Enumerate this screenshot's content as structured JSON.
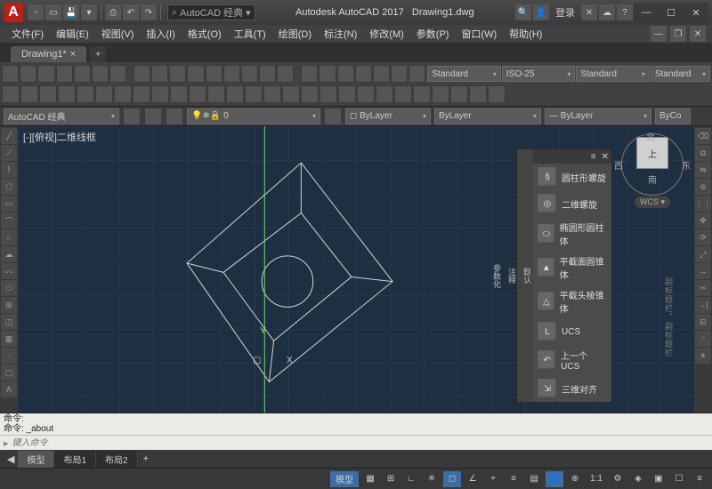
{
  "title": {
    "app": "Autodesk AutoCAD 2017",
    "file": "Drawing1.dwg"
  },
  "search_placeholder": "AutoCAD 经典",
  "login_label": "登录",
  "menus": [
    "文件(F)",
    "编辑(E)",
    "视图(V)",
    "插入(I)",
    "格式(O)",
    "工具(T)",
    "绘图(D)",
    "标注(N)",
    "修改(M)",
    "参数(P)",
    "窗口(W)",
    "帮助(H)"
  ],
  "file_tab": "Drawing1*",
  "prop": {
    "workspace": "AutoCAD 经典",
    "standard1": "Standard",
    "iso": "ISO-25",
    "standard2": "Standard",
    "layer0": "0",
    "bylayer": "ByLayer",
    "bycolor": "ByCo"
  },
  "viewport_label": "[-][俯视]二维线框",
  "viewcube": {
    "n": "北",
    "s": "南",
    "e": "东",
    "w": "西",
    "up": "上",
    "wcs": "WCS"
  },
  "ucs": {
    "x": "X",
    "y": "Y"
  },
  "palette": {
    "tabs": [
      "默认",
      "注释",
      "参数化"
    ],
    "items": [
      "圆柱形螺旋",
      "二维螺旋",
      "椭圆形圆柱体",
      "平截面圆锥体",
      "平截头棱锥体",
      "UCS",
      "上一个 UCS",
      "三维对齐"
    ]
  },
  "hint_side": "副标题栏，副标题栏",
  "cmd": {
    "line1": "命令:",
    "line2": "命令: _about",
    "placeholder": "键入命令",
    "chevron": "▸"
  },
  "layout_tabs": [
    "模型",
    "布局1",
    "布局2"
  ],
  "status": {
    "model": "模型",
    "scale": "1:1"
  }
}
